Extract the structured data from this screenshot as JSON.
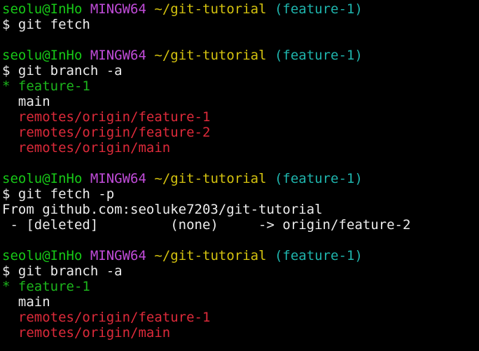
{
  "colors": {
    "background": "#000000",
    "text": "#ececec",
    "prompt_user": "#17c917",
    "prompt_system": "#c04bd8",
    "prompt_path": "#d4c20f",
    "prompt_branch": "#1fb5ad",
    "current_branch": "#1cb51c",
    "remote_branch": "#dd2a3a"
  },
  "prompt": {
    "user": "seolu@InHo",
    "system": "MINGW64",
    "path": "~/git-tutorial",
    "branch": "(feature-1)",
    "symbol": "$"
  },
  "blocks": [
    {
      "command": "git fetch",
      "output": []
    },
    {
      "command": "git branch -a",
      "current_branch": "* feature-1",
      "local_branches": [
        "  main"
      ],
      "remote_branches": [
        "  remotes/origin/feature-1",
        "  remotes/origin/feature-2",
        "  remotes/origin/main"
      ]
    },
    {
      "command": "git fetch -p",
      "output": [
        "From github.com:seoluke7203/git-tutorial",
        " - [deleted]         (none)     -> origin/feature-2"
      ]
    },
    {
      "command": "git branch -a",
      "current_branch": "* feature-1",
      "local_branches": [
        "  main"
      ],
      "remote_branches": [
        "  remotes/origin/feature-1",
        "  remotes/origin/main"
      ]
    }
  ]
}
